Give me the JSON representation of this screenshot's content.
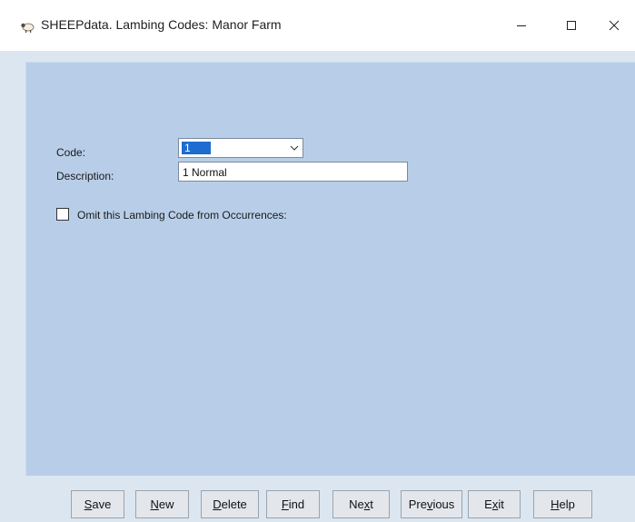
{
  "window": {
    "title": "SHEEPdata. Lambing Codes: Manor Farm",
    "icon": "sheep-icon"
  },
  "form": {
    "code_label": "Code:",
    "code_value": "1",
    "description_label": "Description:",
    "description_value": "1 Normal",
    "omit_label": "Omit this Lambing Code from Occurrences:",
    "omit_checked": false
  },
  "buttons": [
    {
      "pre": "",
      "mnemonic": "S",
      "post": "ave"
    },
    {
      "pre": "",
      "mnemonic": "N",
      "post": "ew"
    },
    {
      "pre": "",
      "mnemonic": "D",
      "post": "elete"
    },
    {
      "pre": "",
      "mnemonic": "F",
      "post": "ind"
    },
    {
      "pre": "Ne",
      "mnemonic": "x",
      "post": "t"
    },
    {
      "pre": "Pre",
      "mnemonic": "v",
      "post": "ious"
    },
    {
      "pre": "E",
      "mnemonic": "x",
      "post": "it"
    },
    {
      "pre": "",
      "mnemonic": "H",
      "post": "elp"
    }
  ]
}
